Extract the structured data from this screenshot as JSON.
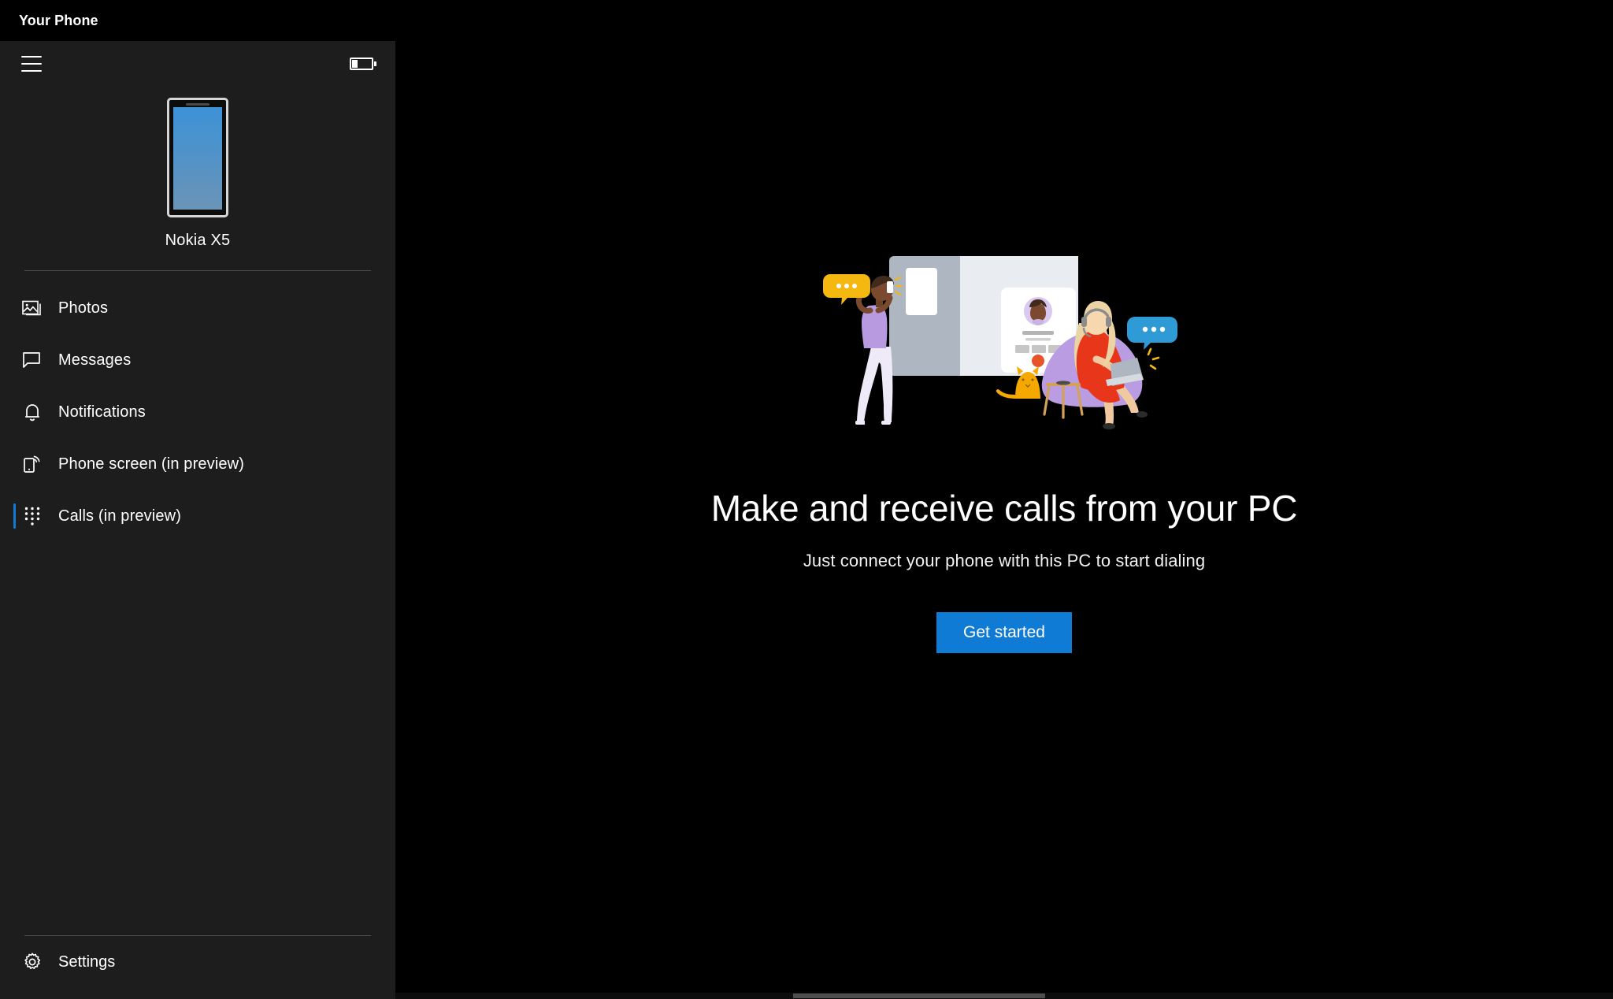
{
  "window": {
    "title": "Your Phone",
    "accent_color": "#0f7bd4",
    "background_color": "#000000",
    "sidebar_color": "#1d1d1d"
  },
  "sidebar": {
    "menu_button": {
      "name": "hamburger-menu",
      "label": "Menu"
    },
    "battery": {
      "name": "battery-icon",
      "label": "Battery"
    },
    "device": {
      "name": "Nokia X5",
      "image_name": "phone-thumbnail"
    },
    "items": [
      {
        "label": "Photos",
        "icon": "photos-icon",
        "selected": false
      },
      {
        "label": "Messages",
        "icon": "messages-icon",
        "selected": false
      },
      {
        "label": "Notifications",
        "icon": "bell-icon",
        "selected": false
      },
      {
        "label": "Phone screen (in preview)",
        "icon": "phone-screen-icon",
        "selected": false
      },
      {
        "label": "Calls (in preview)",
        "icon": "dialpad-icon",
        "selected": true
      }
    ],
    "settings": {
      "label": "Settings",
      "icon": "gear-icon"
    }
  },
  "main": {
    "illustration_name": "calls-hero-illustration",
    "headline": "Make and receive calls from your PC",
    "subhead": "Just connect your phone with this PC to start dialing",
    "cta_label": "Get started"
  }
}
